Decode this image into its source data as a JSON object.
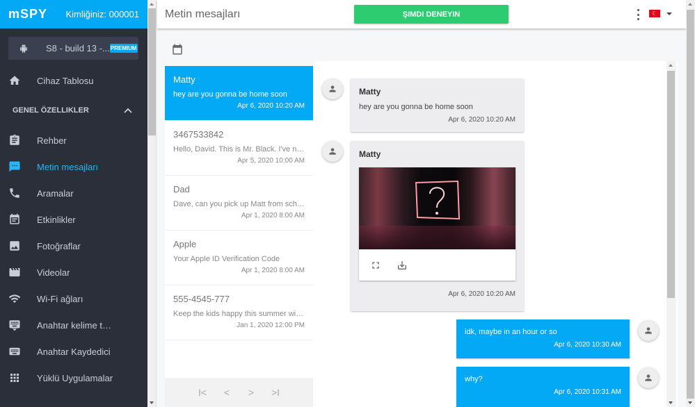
{
  "brand": {
    "logo": "mSPY",
    "user_id_label": "Kimliğiniz: 000001",
    "color": "#03a9f4"
  },
  "device": {
    "icon": "android-icon",
    "name": "S8 - build 13 -...",
    "badge": "PREMIUM"
  },
  "sidebar": {
    "dashboard": {
      "label": "Cihaz Tablosu",
      "icon": "home-icon"
    },
    "section_label": "GENEL ÖZELLIKLER",
    "items": [
      {
        "label": "Rehber",
        "icon": "contacts-clipboard-icon"
      },
      {
        "label": "Metin mesajları",
        "icon": "message-icon",
        "active": true
      },
      {
        "label": "Aramalar",
        "icon": "phone-icon"
      },
      {
        "label": "Etkinlikler",
        "icon": "calendar-icon"
      },
      {
        "label": "Fotoğraflar",
        "icon": "photo-icon"
      },
      {
        "label": "Videolar",
        "icon": "video-icon"
      },
      {
        "label": "Wi-Fi ağları",
        "icon": "wifi-icon"
      },
      {
        "label": "Anahtar kelime ta...",
        "icon": "keyword-keyboard-icon"
      },
      {
        "label": "Anahtar Kaydedici",
        "icon": "keyboard-icon"
      },
      {
        "label": "Yüklü Uygulamalar",
        "icon": "apps-grid-icon"
      }
    ]
  },
  "header": {
    "title": "Metin mesajları",
    "cta_label": "ŞIMDI DENEYIN",
    "cta_color": "#2ecc71",
    "language": "TR"
  },
  "conversations": [
    {
      "name": "Matty",
      "preview": "hey are you gonna be home soon",
      "time": "Apr 6, 2020 10:20 AM",
      "active": true
    },
    {
      "name": "3467533842",
      "preview": "Hello, David. This is Mr. Black. I've noti...",
      "time": "Apr 5, 2020 10:00 AM"
    },
    {
      "name": "Dad",
      "preview": "Dave, can you pick up Matt from schoo...",
      "time": "Apr 1, 2020 8:00 AM"
    },
    {
      "name": "Apple",
      "preview": "Your Apple ID Verification Code",
      "time": "Apr 1, 2020 8:00 AM"
    },
    {
      "name": "555-4545-777",
      "preview": "Keep the kids happy this summer with ...",
      "time": "Jan 1, 2020 12:00 PM"
    }
  ],
  "pager": {
    "first": "I<",
    "prev": "<",
    "next": ">",
    "last": ">I"
  },
  "messages": [
    {
      "direction": "in",
      "sender": "Matty",
      "text": "hey are you gonna be home soon",
      "time": "Apr 6, 2020 10:20 AM"
    },
    {
      "direction": "in",
      "sender": "Matty",
      "media": "image",
      "time": "Apr 6, 2020 10:20 AM"
    },
    {
      "direction": "out",
      "text": "idk, maybe in an hour or so",
      "time": "Apr 6, 2020 10:30 AM"
    },
    {
      "direction": "out",
      "text": "why?",
      "time": "Apr 6, 2020 10:31 AM"
    }
  ]
}
